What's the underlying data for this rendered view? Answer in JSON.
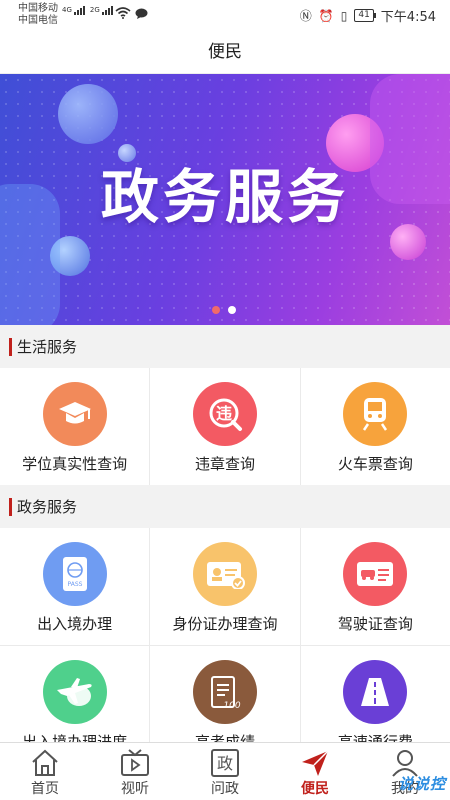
{
  "status_bar": {
    "carrier1": "中国移动",
    "carrier2": "中国电信",
    "net1": "4G",
    "net2": "2G",
    "battery": "41",
    "time": "下午4:54"
  },
  "header": {
    "title": "便民"
  },
  "banner": {
    "title": "政务服务",
    "page_count": 2,
    "active_page": 1
  },
  "sections": [
    {
      "title": "生活服务",
      "items": [
        {
          "label": "学位真实性查询",
          "icon": "graduation-cap-icon",
          "color": "#f28a5a"
        },
        {
          "label": "违章查询",
          "icon": "violation-search-icon",
          "color": "#f35a63"
        },
        {
          "label": "火车票查询",
          "icon": "train-icon",
          "color": "#f7a33c"
        }
      ]
    },
    {
      "title": "政务服务",
      "items": [
        {
          "label": "出入境办理",
          "icon": "passport-icon",
          "color": "#6f9cf2"
        },
        {
          "label": "身份证办理查询",
          "icon": "id-card-icon",
          "color": "#f8c36b"
        },
        {
          "label": "驾驶证查询",
          "icon": "driver-license-icon",
          "color": "#f35a63"
        },
        {
          "label": "出入境办理进度",
          "icon": "airplane-icon",
          "color": "#4fd08c"
        },
        {
          "label": "高考成绩",
          "icon": "exam-score-icon",
          "color": "#8a5a3c"
        },
        {
          "label": "高速通行费",
          "icon": "highway-icon",
          "color": "#6a3fd6"
        }
      ]
    }
  ],
  "tabbar": [
    {
      "label": "首页",
      "icon": "home-icon"
    },
    {
      "label": "视听",
      "icon": "tv-icon"
    },
    {
      "label": "问政",
      "icon": "zheng-icon",
      "glyph": "政"
    },
    {
      "label": "便民",
      "icon": "paper-plane-icon",
      "active": true
    },
    {
      "label": "我的",
      "icon": "user-icon"
    }
  ],
  "watermark": "说说控",
  "colors": {
    "accent": "#c0211c"
  }
}
